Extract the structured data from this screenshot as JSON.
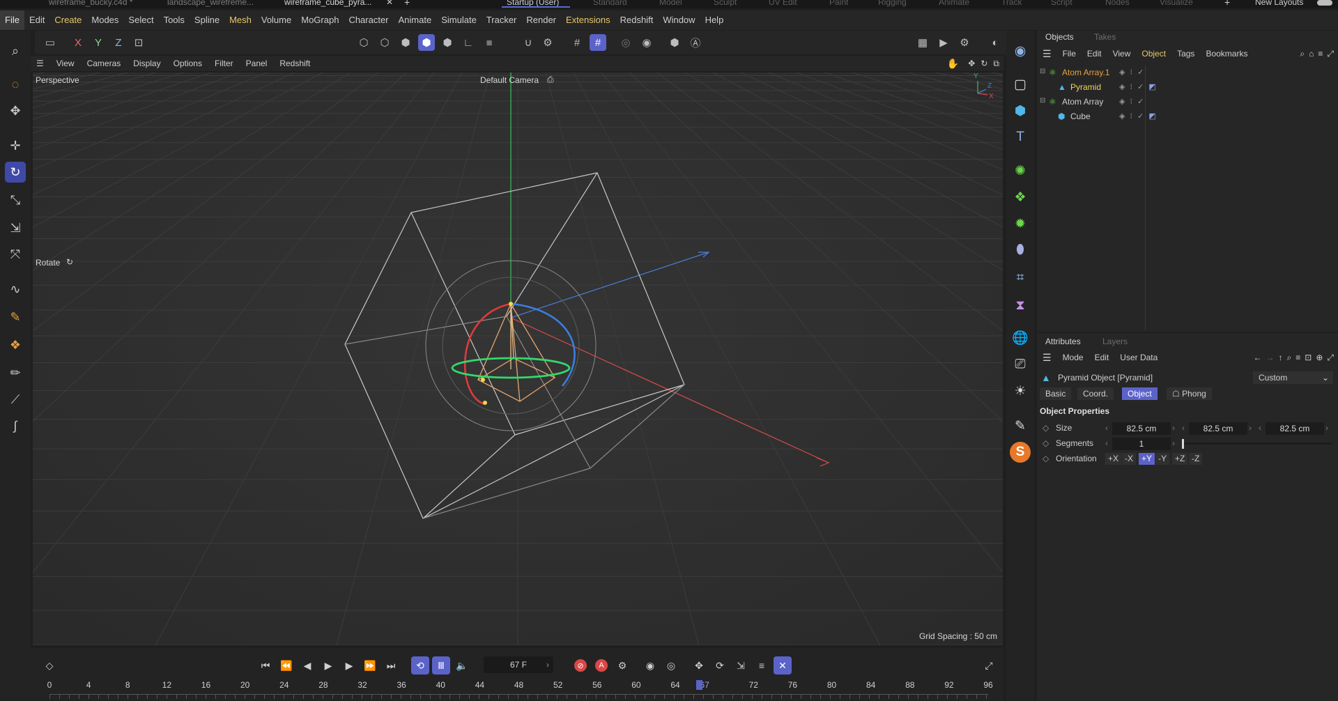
{
  "file_tabs": [
    {
      "label": "wireframe_bucky.c4d *",
      "active": false
    },
    {
      "label": "landscape_wirefreme...",
      "active": false
    },
    {
      "label": "wireframe_cube_pyra...",
      "active": true
    }
  ],
  "layout_tabs": [
    {
      "label": "Startup (User)",
      "active": true
    },
    {
      "label": "Standard"
    },
    {
      "label": "Model"
    },
    {
      "label": "Sculpt"
    },
    {
      "label": "UV Edit"
    },
    {
      "label": "Paint"
    },
    {
      "label": "Rigging"
    },
    {
      "label": "Animate"
    },
    {
      "label": "Track"
    },
    {
      "label": "Script"
    },
    {
      "label": "Nodes"
    },
    {
      "label": "Visualize"
    }
  ],
  "new_layouts_label": "New Layouts",
  "menu": {
    "items": [
      "File",
      "Edit",
      "Create",
      "Modes",
      "Select",
      "Tools",
      "Spline",
      "Mesh",
      "Volume",
      "MoGraph",
      "Character",
      "Animate",
      "Simulate",
      "Tracker",
      "Render",
      "Extensions",
      "Redshift",
      "Window",
      "Help"
    ],
    "highlighted": [
      "Create",
      "Mesh",
      "Extensions"
    ]
  },
  "axis_labels": [
    "X",
    "Y",
    "Z"
  ],
  "viewport_menu": [
    "View",
    "Cameras",
    "Display",
    "Options",
    "Filter",
    "Panel",
    "Redshift"
  ],
  "viewport": {
    "view_name": "Perspective",
    "camera": "Default Camera",
    "tool_hint": "Rotate",
    "grid_spacing": "Grid Spacing : 50 cm",
    "gizmo_axes": [
      "Y",
      "Z",
      "X"
    ]
  },
  "timeline": {
    "current_frame": "67 F",
    "ticks": [
      "0",
      "4",
      "8",
      "12",
      "16",
      "20",
      "24",
      "28",
      "32",
      "36",
      "40",
      "44",
      "48",
      "52",
      "56",
      "60",
      "64",
      "67",
      "72",
      "76",
      "80",
      "84",
      "88",
      "92",
      "96"
    ],
    "playhead": 67,
    "max": 96
  },
  "objects_panel": {
    "tabs": [
      "Objects",
      "Takes"
    ],
    "menu": [
      "File",
      "Edit",
      "View",
      "Object",
      "Tags",
      "Bookmarks"
    ],
    "highlighted_menu": "Object",
    "items": [
      {
        "name": "Atom Array.1",
        "depth": 0,
        "color": "#e8a23c"
      },
      {
        "name": "Pyramid",
        "depth": 1,
        "color": "#f0d35c"
      },
      {
        "name": "Atom Array",
        "depth": 0,
        "color": "#cfcfcf"
      },
      {
        "name": "Cube",
        "depth": 1,
        "color": "#cfcfcf"
      }
    ]
  },
  "attributes_panel": {
    "tabs": [
      "Attributes",
      "Layers"
    ],
    "menu": [
      "Mode",
      "Edit",
      "User Data"
    ],
    "object_title": "Pyramid Object [Pyramid]",
    "preset": "Custom",
    "subtabs": [
      "Basic",
      "Coord.",
      "Object",
      "Phong"
    ],
    "selected_subtab": "Object",
    "section": "Object Properties",
    "size_label": "Size",
    "size_values": [
      "82.5 cm",
      "82.5 cm",
      "82.5 cm"
    ],
    "segments_label": "Segments",
    "segments_value": "1",
    "orientation_label": "Orientation",
    "orientation_options": [
      "+X",
      "-X",
      "+Y",
      "-Y",
      "+Z",
      "-Z"
    ],
    "orientation_selected": "+Y"
  },
  "colors": {
    "accent": "#5b63c9",
    "highlight_text": "#e8c76a",
    "y_axis": "#3fbf5f",
    "x_axis": "#d84a4a",
    "z_axis": "#4a7fd8"
  }
}
